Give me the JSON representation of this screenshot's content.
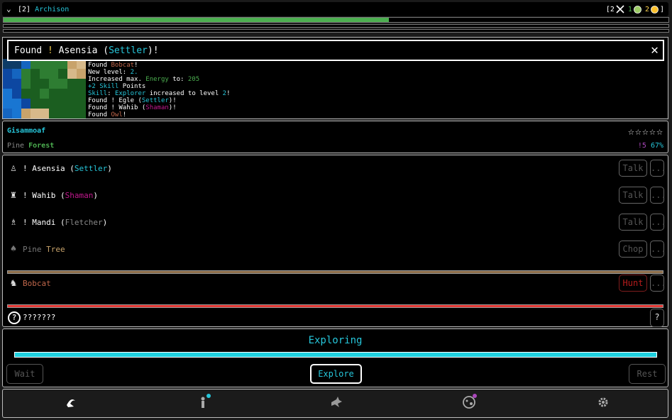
{
  "header": {
    "prefix": "[2]",
    "name": "Archison",
    "stat1_open": "[2",
    "stat2": "1",
    "stat3": "2",
    "stat3_close": "]",
    "xp_fraction": 0.58
  },
  "popup": {
    "found": "Found",
    "bang": "!",
    "name": "Asensia",
    "open": "(",
    "role": "Settler",
    "close": ")!"
  },
  "log": [
    {
      "parts": [
        {
          "t": "Found ",
          "c": "#ffffff"
        },
        {
          "t": "Bobcat",
          "c": "#c0674b"
        },
        {
          "t": "!",
          "c": "#ffffff"
        }
      ]
    },
    {
      "parts": [
        {
          "t": "New level: ",
          "c": "#ffffff"
        },
        {
          "t": "2.",
          "c": "#26c6da"
        }
      ]
    },
    {
      "parts": [
        {
          "t": "Increased max. ",
          "c": "#ffffff"
        },
        {
          "t": "Energy",
          "c": "#4caf50"
        },
        {
          "t": " to: ",
          "c": "#ffffff"
        },
        {
          "t": "205",
          "c": "#4caf50"
        }
      ]
    },
    {
      "parts": [
        {
          "t": "+2 Skill",
          "c": "#26c6da"
        },
        {
          "t": " Points",
          "c": "#ffffff"
        }
      ]
    },
    {
      "parts": [
        {
          "t": "Skill",
          "c": "#26c6da"
        },
        {
          "t": ": ",
          "c": "#ffffff"
        },
        {
          "t": "Explorer",
          "c": "#26c6da"
        },
        {
          "t": " increased to level ",
          "c": "#ffffff"
        },
        {
          "t": "2",
          "c": "#26c6da"
        },
        {
          "t": "!",
          "c": "#ffffff"
        }
      ]
    },
    {
      "parts": [
        {
          "t": "Found ! Egle (",
          "c": "#ffffff"
        },
        {
          "t": "Settler",
          "c": "#26c6da"
        },
        {
          "t": ")!",
          "c": "#ffffff"
        }
      ]
    },
    {
      "parts": [
        {
          "t": "Found ! Wahib (",
          "c": "#ffffff"
        },
        {
          "t": "Shaman",
          "c": "#c2188e"
        },
        {
          "t": ")!",
          "c": "#ffffff"
        }
      ]
    },
    {
      "parts": [
        {
          "t": "Found ",
          "c": "#ffffff"
        },
        {
          "t": "Owl",
          "c": "#c0674b"
        },
        {
          "t": "!",
          "c": "#ffffff"
        }
      ]
    }
  ],
  "location": {
    "name": "Gisammoaf",
    "biome1": "Pine",
    "biome2": "Forest",
    "stars": "☆☆☆☆☆",
    "stat1": "!5",
    "stat2": "67%"
  },
  "entities": [
    {
      "icon": "♙",
      "bang": "! ",
      "name": "Asensia",
      "open": " (",
      "role": "Settler",
      "close": ")",
      "role_color": "#26c6da",
      "btn": "Talk",
      "more": "..."
    },
    {
      "icon": "♜",
      "bang": "! ",
      "name": "Wahib",
      "open": " (",
      "role": "Shaman",
      "close": ")",
      "role_color": "#c2188e",
      "btn": "Talk",
      "more": "..."
    },
    {
      "icon": "♗",
      "bang": "! ",
      "name": "Mandi",
      "open": " (",
      "role": "Fletcher",
      "close": ")",
      "role_color": "#888888",
      "btn": "Talk",
      "more": "..."
    },
    {
      "icon": "♠",
      "name1": "Pine",
      "name2": "Tree",
      "btn": "Chop",
      "more": "...",
      "bar_fill": 1.0,
      "bar_color": "#8d6e4a"
    },
    {
      "icon": "♞",
      "name1": "Bobcat",
      "btn": "Hunt",
      "more": "...",
      "bar_fill": 1.0,
      "bar_color": "#e53935"
    },
    {
      "icon": "?",
      "name1": "???????",
      "more": "?"
    }
  ],
  "exploring": {
    "title": "Exploring",
    "progress": 1.0,
    "wait": "Wait",
    "explore": "Explore",
    "rest": "Rest"
  },
  "nav": {
    "items": [
      "explore-icon",
      "character-icon",
      "crafting-icon",
      "world-icon",
      "settings-icon"
    ],
    "character_dot": "#26c6da",
    "world_dot": "#ab47bc"
  }
}
